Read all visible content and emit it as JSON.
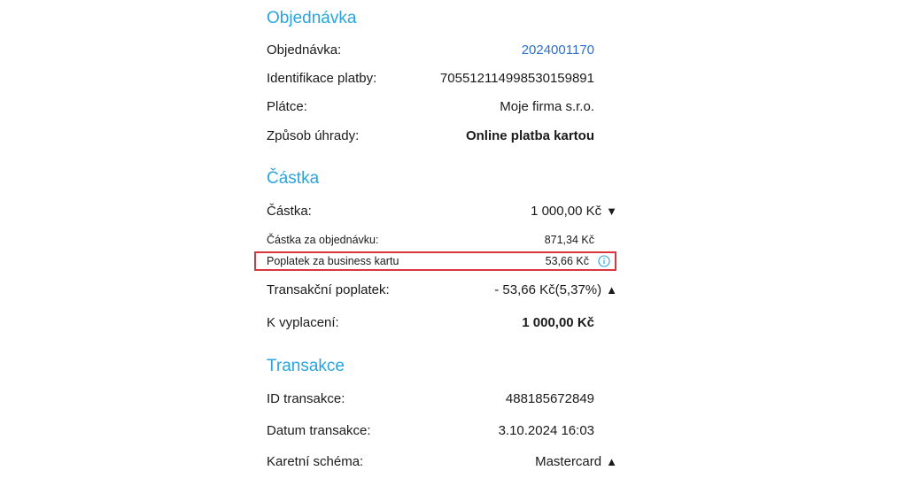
{
  "order_section": {
    "title": "Objednávka",
    "rows": [
      {
        "label": "Objednávka:",
        "value": "2024001170"
      },
      {
        "label": "Identifikace platby:",
        "value": "705512114998530159891"
      },
      {
        "label": "Plátce:",
        "value": "Moje firma s.r.o."
      },
      {
        "label": "Způsob úhrady:",
        "value": "Online platba kartou"
      }
    ]
  },
  "amount_section": {
    "title": "Částka",
    "amount": {
      "label": "Částka:",
      "value": "1 000,00 Kč",
      "caret": "▼"
    },
    "order_amount": {
      "label": "Částka za objednávku:",
      "value": "871,34 Kč"
    },
    "business_card_fee": {
      "label": "Poplatek za business kartu",
      "value": "53,66 Kč",
      "icon": "info-icon"
    },
    "transaction_fee": {
      "label": "Transakční poplatek:",
      "value": "- 53,66 Kč(5,37%)",
      "caret": "▲"
    },
    "payout": {
      "label": "K vyplacení:",
      "value": "1 000,00 Kč"
    }
  },
  "transaction_section": {
    "title": "Transakce",
    "rows": [
      {
        "label": "ID transakce:",
        "value": "488185672849"
      },
      {
        "label": "Datum transakce:",
        "value": "3.10.2024 16:03"
      },
      {
        "label": "Karetní schéma:",
        "value": "Mastercard",
        "caret": "▲"
      }
    ]
  },
  "colors": {
    "section_title": "#2aa4df",
    "link": "#2b6fcf",
    "highlight_border": "#d9363e"
  }
}
